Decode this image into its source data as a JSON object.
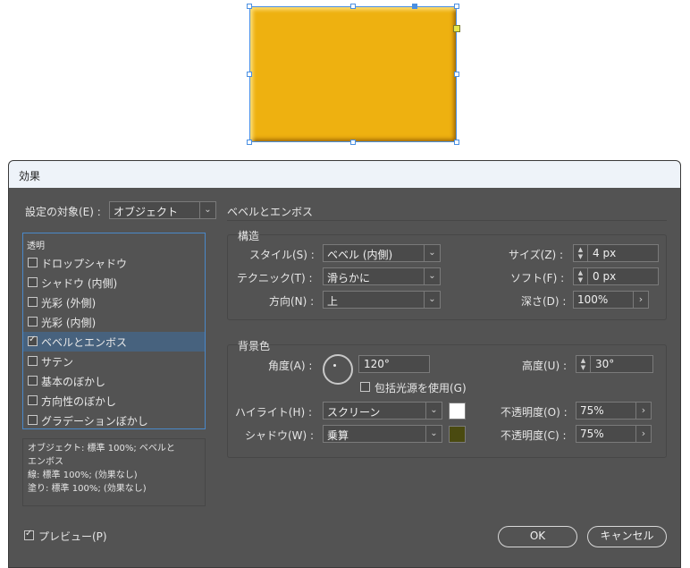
{
  "dialog": {
    "title": "効果",
    "settings_for_label": "設定の対象(E) :",
    "settings_for_value": "オブジェクト",
    "section_title": "ベベルとエンボス",
    "effects_list": [
      {
        "label": "透明",
        "checkbox": false,
        "checked": false,
        "selected": false
      },
      {
        "label": "ドロップシャドウ",
        "checkbox": true,
        "checked": false,
        "selected": false
      },
      {
        "label": "シャドウ (内側)",
        "checkbox": true,
        "checked": false,
        "selected": false
      },
      {
        "label": "光彩 (外側)",
        "checkbox": true,
        "checked": false,
        "selected": false
      },
      {
        "label": "光彩 (内側)",
        "checkbox": true,
        "checked": false,
        "selected": false
      },
      {
        "label": "ベベルとエンボス",
        "checkbox": true,
        "checked": true,
        "selected": true
      },
      {
        "label": "サテン",
        "checkbox": true,
        "checked": false,
        "selected": false
      },
      {
        "label": "基本のぼかし",
        "checkbox": true,
        "checked": false,
        "selected": false
      },
      {
        "label": "方向性のぼかし",
        "checkbox": true,
        "checked": false,
        "selected": false
      },
      {
        "label": "グラデーションぼかし",
        "checkbox": true,
        "checked": false,
        "selected": false
      }
    ],
    "summary": {
      "line1": "オブジェクト: 標準 100%; ベベルと",
      "line2": "エンボス",
      "line3": "線: 標準 100%; (効果なし)",
      "line4": "塗り: 標準 100%; (効果なし)"
    },
    "structure": {
      "title": "構造",
      "style_label": "スタイル(S) :",
      "style_value": "ベベル (内側)",
      "technique_label": "テクニック(T) :",
      "technique_value": "滑らかに",
      "direction_label": "方向(N) :",
      "direction_value": "上",
      "size_label": "サイズ(Z) :",
      "size_value": "4 px",
      "soften_label": "ソフト(F) :",
      "soften_value": "0 px",
      "depth_label": "深さ(D) :",
      "depth_value": "100%"
    },
    "shading": {
      "title": "背景色",
      "angle_label": "角度(A) :",
      "angle_value": "120°",
      "global_light_label": "包括光源を使用(G)",
      "global_light_checked": false,
      "altitude_label": "高度(U) :",
      "altitude_value": "30°",
      "highlight_label": "ハイライト(H) :",
      "highlight_value": "スクリーン",
      "highlight_color": "#ffffff",
      "highlight_opacity_label": "不透明度(O) :",
      "highlight_opacity_value": "75%",
      "shadow_label": "シャドウ(W) :",
      "shadow_value": "乗算",
      "shadow_color": "#4a4a10",
      "shadow_opacity_label": "不透明度(C) :",
      "shadow_opacity_value": "75%"
    },
    "preview_label": "プレビュー(P)",
    "preview_checked": true,
    "ok_label": "OK",
    "cancel_label": "キャンセル"
  },
  "canvas": {
    "object_color": "#eeb110",
    "selection_color": "#4a8fe2"
  }
}
